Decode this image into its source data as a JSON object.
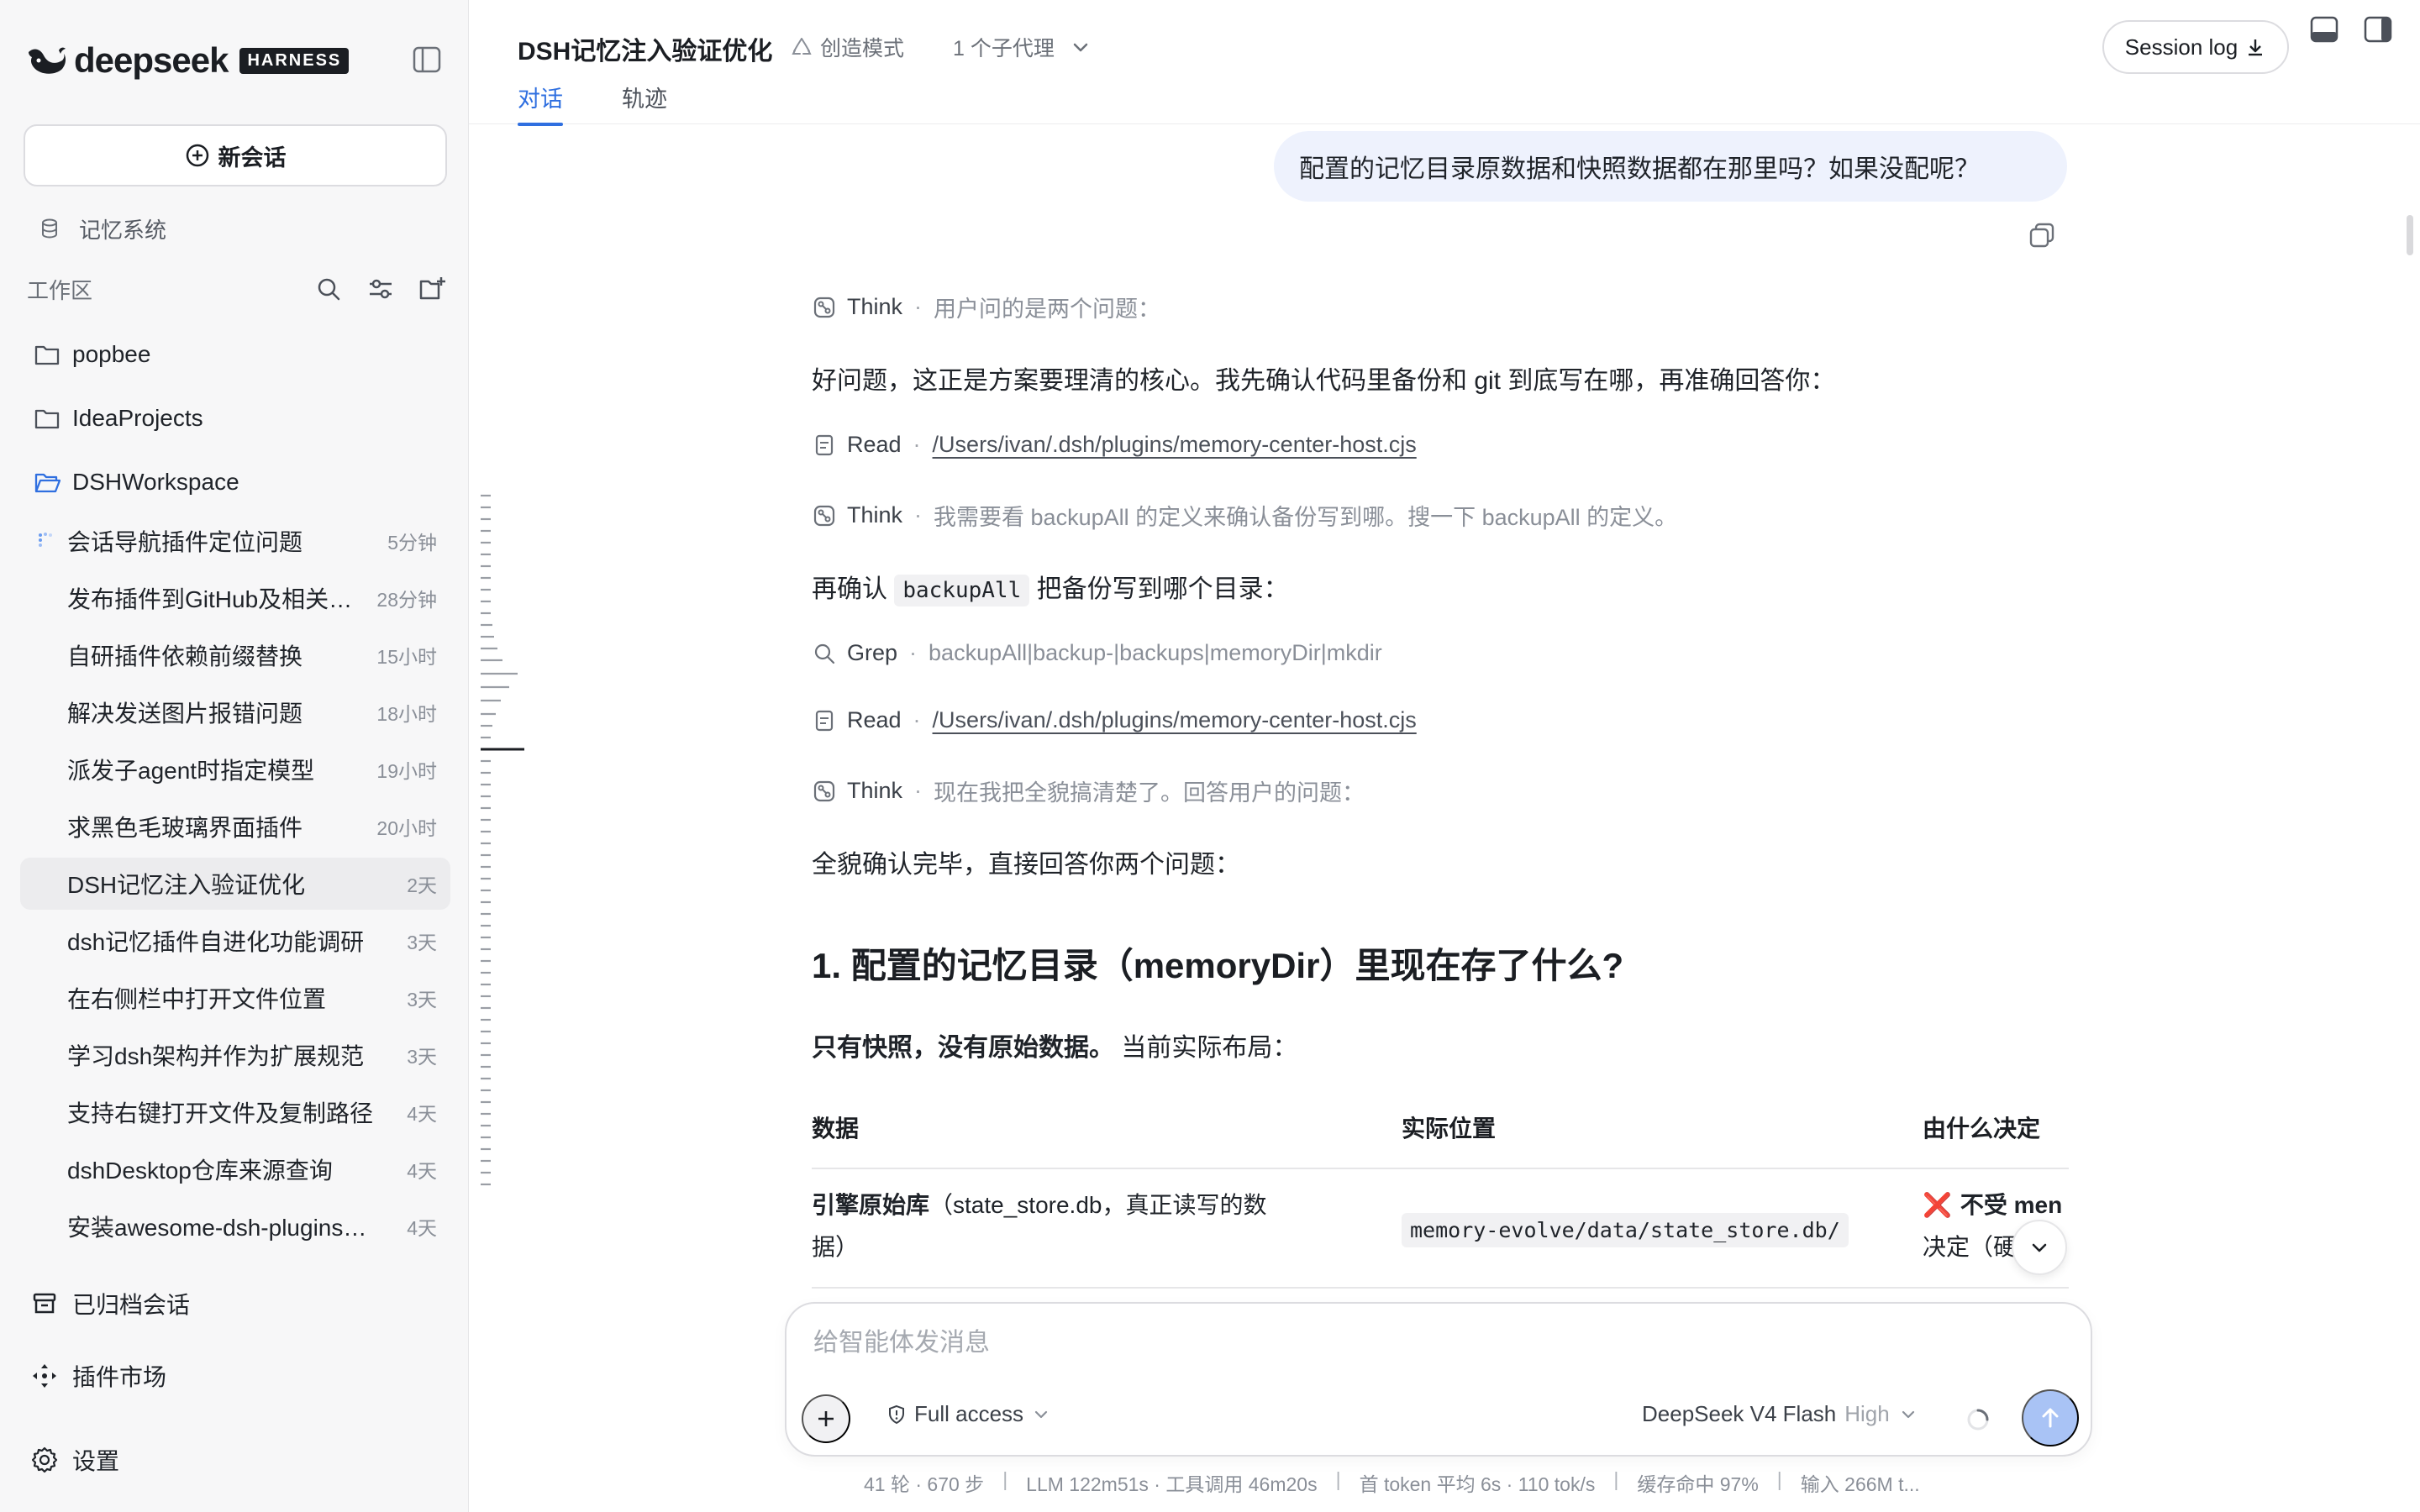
{
  "brand": {
    "name": "deepseek",
    "badge": "HARNESS"
  },
  "sidebar": {
    "new_chat_label": "新会话",
    "memory_label": "记忆系统",
    "workspace_label": "工作区",
    "folders": [
      "popbee",
      "IdeaProjects",
      "DSHWorkspace"
    ],
    "sessions": [
      {
        "title": "会话导航插件定位问题",
        "time": "5分钟"
      },
      {
        "title": "发布插件到GitHub及相关…",
        "time": "28分钟"
      },
      {
        "title": "自研插件依赖前缀替换",
        "time": "15小时"
      },
      {
        "title": "解决发送图片报错问题",
        "time": "18小时"
      },
      {
        "title": "派发子agent时指定模型",
        "time": "19小时"
      },
      {
        "title": "求黑色毛玻璃界面插件",
        "time": "20小时"
      },
      {
        "title": "DSH记忆注入验证优化",
        "time": "2天"
      },
      {
        "title": "dsh记忆插件自进化功能调研",
        "time": "3天"
      },
      {
        "title": "在右侧栏中打开文件位置",
        "time": "3天"
      },
      {
        "title": "学习dsh架构并作为扩展规范",
        "time": "3天"
      },
      {
        "title": "支持右键打开文件及复制路径",
        "time": "4天"
      },
      {
        "title": "dshDesktop仓库来源查询",
        "time": "4天"
      },
      {
        "title": "安装awesome-dsh-plugins…",
        "time": "4天"
      }
    ],
    "archived_label": "已归档会话",
    "market_label": "插件市场",
    "settings_label": "设置"
  },
  "header": {
    "title": "DSH记忆注入验证优化",
    "mode": "创造模式",
    "agents": "1 个子代理",
    "tabs": [
      "对话",
      "轨迹"
    ],
    "session_log": "Session log"
  },
  "chat": {
    "user_message": "配置的记忆目录原数据和快照数据都在那里吗？如果没配呢？",
    "think1_label": "Think",
    "think1_text": "用户问的是两个问题：",
    "para1": "好问题，这正是方案要理清的核心。我先确认代码里备份和 git 到底写在哪，再准确回答你：",
    "read1_label": "Read",
    "read1_path": "/Users/ivan/.dsh/plugins/memory-center-host.cjs",
    "think2_label": "Think",
    "think2_text": "我需要看 backupAll 的定义来确认备份写到哪。搜一下 backupAll 的定义。",
    "para2_pre": "再确认",
    "para2_code": "backupAll",
    "para2_post": "把备份写到哪个目录：",
    "grep_label": "Grep",
    "grep_text": "backupAll|backup-|backups|memoryDir|mkdir",
    "read2_label": "Read",
    "read2_path": "/Users/ivan/.dsh/plugins/memory-center-host.cjs",
    "think3_label": "Think",
    "think3_text": "现在我把全貌搞清楚了。回答用户的问题：",
    "para3": "全貌确认完毕，直接回答你两个问题：",
    "heading1": "1. 配置的记忆目录（memoryDir）里现在存了什么?",
    "para4_bold": "只有快照，没有原始数据。",
    "para4_rest": "当前实际布局：",
    "table": {
      "headers": [
        "数据",
        "实际位置",
        "由什么决定"
      ],
      "row1_col1_bold": "引擎原始库",
      "row1_col1_line1_rest": "（state_store.db，真正读写的数",
      "row1_col1_line2": "据）",
      "row1_col2": "memory-evolve/data/state_store.db/",
      "row1_col3_mark": "❌",
      "row1_col3_line1": "不受 men",
      "row1_col3_line2": "决定（硬"
    }
  },
  "composer": {
    "placeholder": "给智能体发消息",
    "access": "Full access",
    "model": "DeepSeek V4 Flash",
    "effort": "High"
  },
  "stats": [
    "41 轮 · 670 步",
    "LLM 122m51s · 工具调用 46m20s",
    "首 token 平均 6s · 110 tok/s",
    "缓存命中 97%",
    "输入 266M t..."
  ]
}
